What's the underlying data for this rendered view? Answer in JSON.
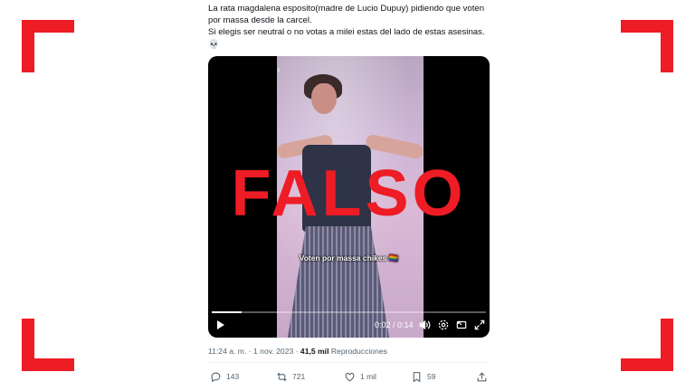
{
  "tweet": {
    "lines": [
      "La rata magdalena esposito(madre de Lucio Dupuy) pidiendo que voten",
      "por massa desde la carcel.",
      "Si elegis ser neutral o no votas a milei estas del lado de estas asesinas."
    ],
    "emoji": "💀"
  },
  "video": {
    "caption": "Voten por massa chikes 🏳️‍🌈",
    "stamp": "FALSO",
    "time": "0:02 / 0:14",
    "progress": 0.11
  },
  "meta": {
    "timestamp": "11:24 a. m. · 1 nov. 2023 · ",
    "views_count": "41,5 mil",
    "views_label": " Reproducciones"
  },
  "actions": {
    "replies": "143",
    "reposts": "721",
    "likes": "1 mil",
    "bookmarks": "59"
  },
  "colors": {
    "accent_red": "#ee1c25",
    "muted": "#536471"
  }
}
